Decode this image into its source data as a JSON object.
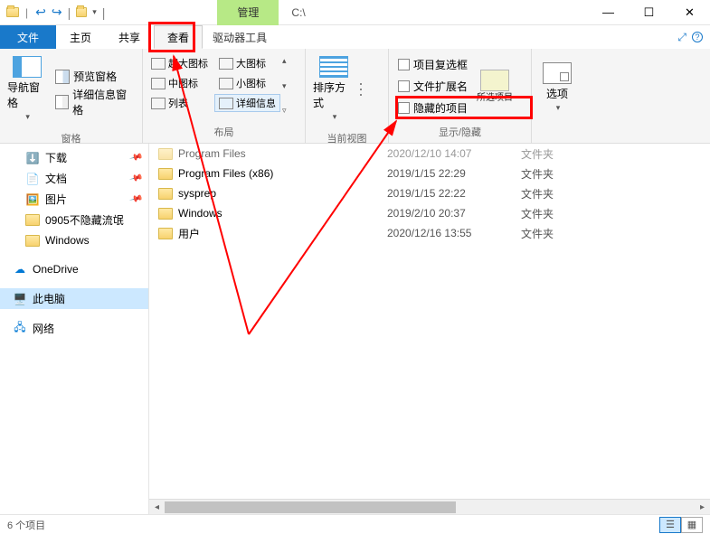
{
  "title": {
    "manage": "管理",
    "path": "C:\\"
  },
  "win": {
    "min": "—",
    "max": "☐",
    "close": "✕"
  },
  "tabs": {
    "file": "文件",
    "home": "主页",
    "share": "共享",
    "view": "查看",
    "driver": "驱动器工具"
  },
  "ribbon": {
    "panes": {
      "label": "窗格",
      "nav": "导航窗格",
      "preview": "预览窗格",
      "detail": "详细信息窗格"
    },
    "layout": {
      "label": "布局",
      "items": [
        "超大图标",
        "大图标",
        "中图标",
        "小图标",
        "列表",
        "详细信息"
      ]
    },
    "view": {
      "label": "当前视图",
      "sort": "排序方式"
    },
    "showhide": {
      "label": "显示/隐藏",
      "checkboxes": "项目复选框",
      "ext": "文件扩展名",
      "hidden": "隐藏的项目",
      "selected": "所选项目"
    },
    "options": {
      "label": "选项",
      "btn": "选项"
    }
  },
  "nav": {
    "downloads": "下载",
    "documents": "文档",
    "pictures": "图片",
    "folder1": "0905不隐藏流氓",
    "folder2": "Windows",
    "onedrive": "OneDrive",
    "thispc": "此电脑",
    "network": "网络"
  },
  "files": [
    {
      "name": "Program Files",
      "date": "2020/12/10 14:07",
      "type": "文件夹"
    },
    {
      "name": "Program Files (x86)",
      "date": "2019/1/15 22:29",
      "type": "文件夹"
    },
    {
      "name": "sysprep",
      "date": "2019/1/15 22:22",
      "type": "文件夹"
    },
    {
      "name": "Windows",
      "date": "2019/2/10 20:37",
      "type": "文件夹"
    },
    {
      "name": "用户",
      "date": "2020/12/16 13:55",
      "type": "文件夹"
    }
  ],
  "status": {
    "count": "6 个项目"
  }
}
